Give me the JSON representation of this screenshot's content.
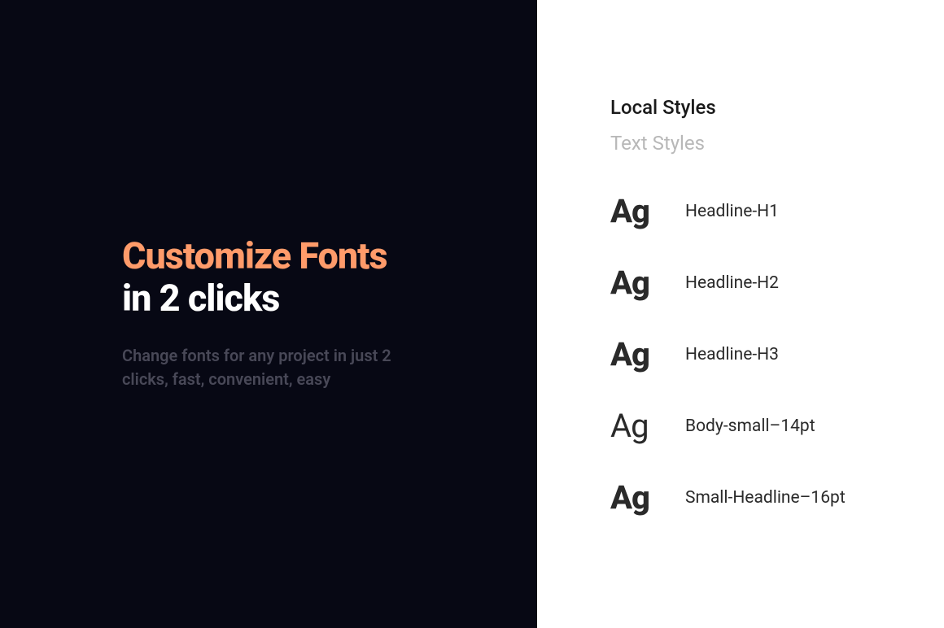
{
  "hero": {
    "title_line1": "Customize Fonts",
    "title_line2": "in 2 clicks",
    "subtitle": "Change fonts for any project in just 2 clicks, fast, convenient, easy"
  },
  "panel": {
    "section_title": "Local Styles",
    "section_subtitle": "Text Styles",
    "styles": [
      {
        "preview": "Ag",
        "weight": "bold",
        "label": "Headline-H1"
      },
      {
        "preview": "Ag",
        "weight": "bold",
        "label": "Headline-H2"
      },
      {
        "preview": "Ag",
        "weight": "bold",
        "label": "Headline-H3"
      },
      {
        "preview": "Ag",
        "weight": "regular",
        "label": "Body-small–14pt"
      },
      {
        "preview": "Ag",
        "weight": "bold",
        "label": "Small-Headline–16pt"
      }
    ]
  }
}
